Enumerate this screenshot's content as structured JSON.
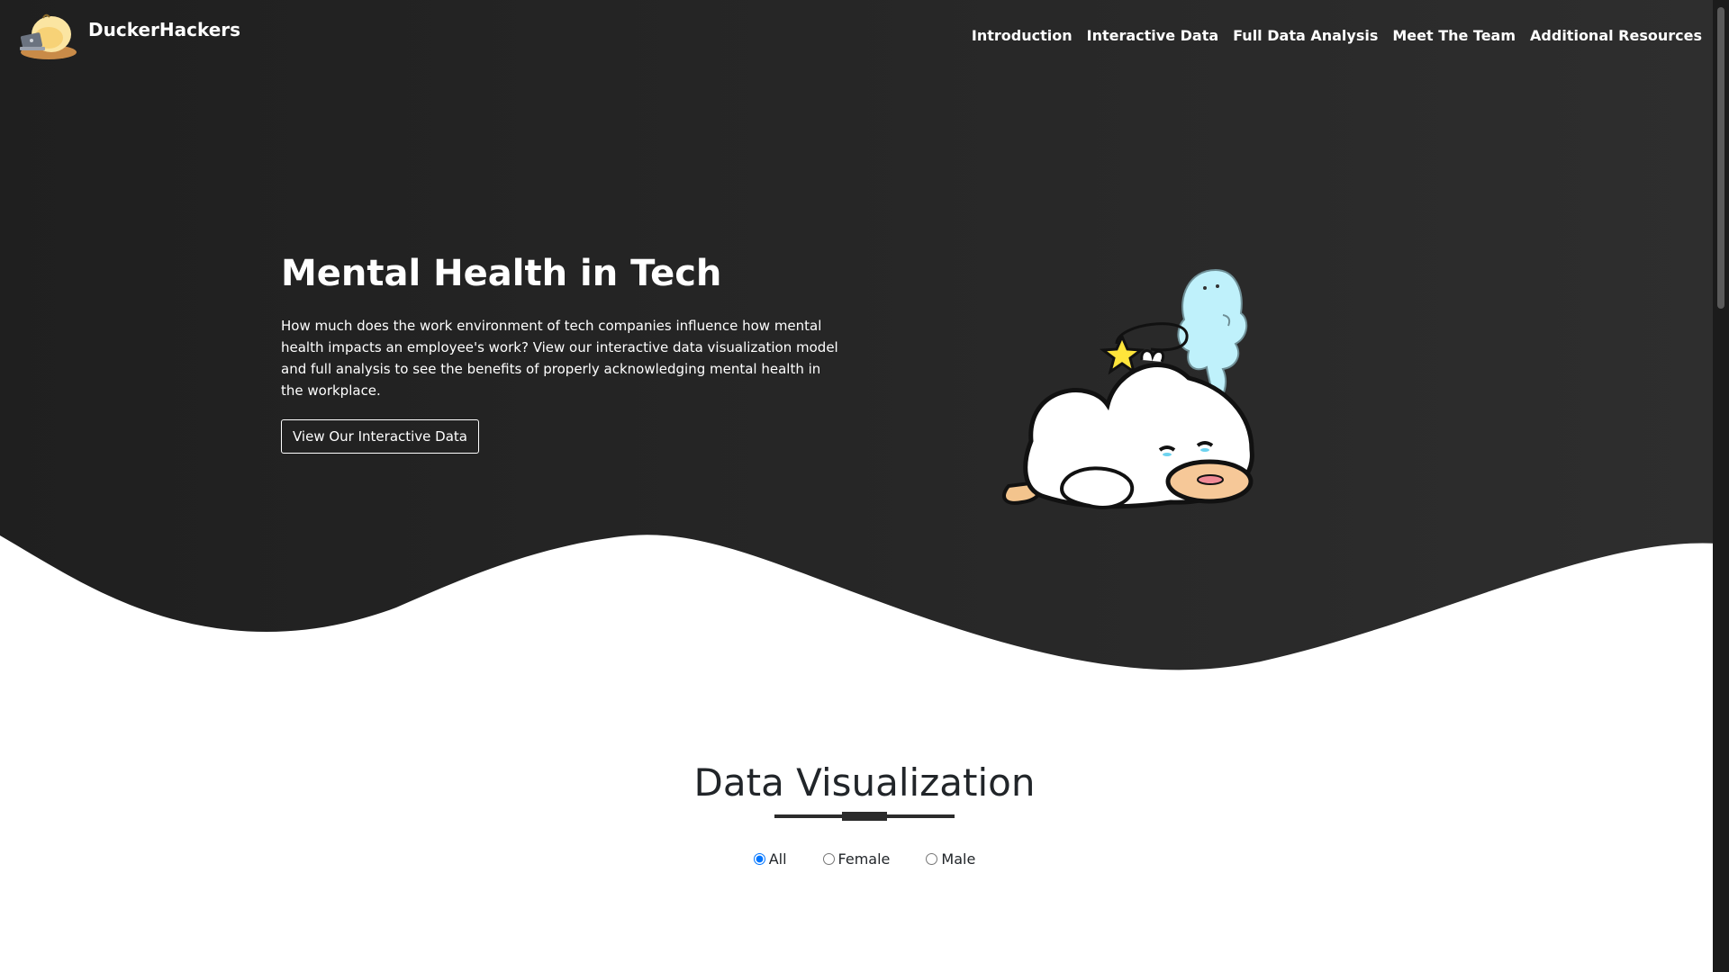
{
  "brand": {
    "name": "DuckerHackers",
    "logo_icon": "duck-laptop-logo-icon"
  },
  "nav": {
    "items": [
      {
        "label": "Introduction"
      },
      {
        "label": "Interactive Data"
      },
      {
        "label": "Full Data Analysis"
      },
      {
        "label": "Meet The Team"
      },
      {
        "label": "Additional Resources"
      }
    ]
  },
  "hero": {
    "title": "Mental Health in Tech",
    "description": "How much does the work environment of tech companies influence how mental health impacts an employee's work? View our interactive data visualization model and full analysis to see the benefits of properly acknowledging mental health in the workplace.",
    "cta_label": "View Our Interactive Data",
    "illustration_icon": "exhausted-duck-ghost-icon"
  },
  "data_section": {
    "title": "Data Visualization",
    "filters": [
      {
        "label": "All",
        "checked": true
      },
      {
        "label": "Female",
        "checked": false
      },
      {
        "label": "Male",
        "checked": false
      }
    ]
  },
  "colors": {
    "hero_dark": "#222222",
    "hero_dark_alt": "#2b2b2b",
    "text_light": "#ffffff",
    "text_dark": "#212529",
    "ghost_blue": "#bff1fb",
    "beak_peach": "#f6c898"
  }
}
